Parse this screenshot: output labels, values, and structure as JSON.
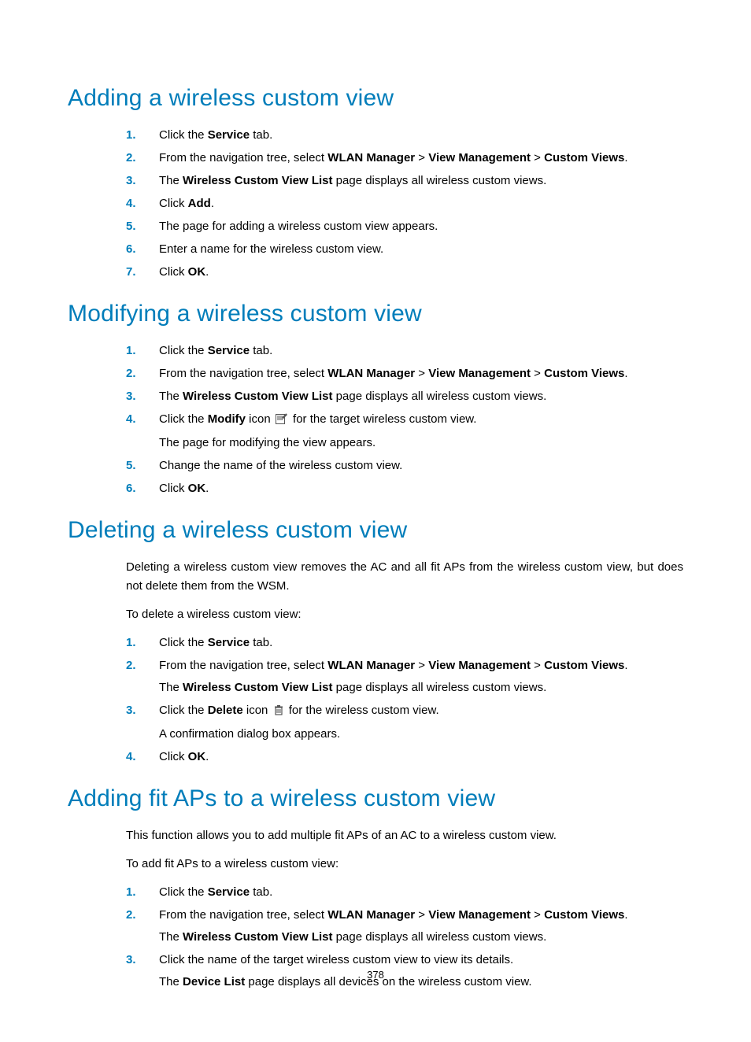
{
  "page_number": "378",
  "sections": [
    {
      "heading": "Adding a wireless custom view",
      "paragraphs": [],
      "steps": [
        {
          "num": "1.",
          "parts": [
            "Click the ",
            {
              "b": "Service"
            },
            " tab."
          ]
        },
        {
          "num": "2.",
          "parts": [
            "From the navigation tree, select ",
            {
              "b": "WLAN Manager"
            },
            " > ",
            {
              "b": "View Management"
            },
            " > ",
            {
              "b": "Custom Views"
            },
            "."
          ]
        },
        {
          "num": "3.",
          "parts": [
            "The ",
            {
              "b": "Wireless Custom View List"
            },
            " page displays all wireless custom views."
          ]
        },
        {
          "num": "4.",
          "parts": [
            "Click ",
            {
              "b": "Add"
            },
            "."
          ]
        },
        {
          "num": "5.",
          "parts": [
            "The page for adding a wireless custom view appears."
          ]
        },
        {
          "num": "6.",
          "parts": [
            "Enter a name for the wireless custom view."
          ]
        },
        {
          "num": "7.",
          "parts": [
            "Click ",
            {
              "b": "OK"
            },
            "."
          ]
        }
      ]
    },
    {
      "heading": "Modifying a wireless custom view",
      "paragraphs": [],
      "steps": [
        {
          "num": "1.",
          "parts": [
            "Click the ",
            {
              "b": "Service"
            },
            " tab."
          ]
        },
        {
          "num": "2.",
          "parts": [
            "From the navigation tree, select ",
            {
              "b": "WLAN Manager"
            },
            " > ",
            {
              "b": "View Management"
            },
            " > ",
            {
              "b": "Custom Views"
            },
            "."
          ]
        },
        {
          "num": "3.",
          "parts": [
            "The ",
            {
              "b": "Wireless Custom View List"
            },
            " page displays all wireless custom views."
          ]
        },
        {
          "num": "4.",
          "parts": [
            "Click the ",
            {
              "b": "Modify"
            },
            " icon ",
            {
              "icon": "modify"
            },
            " for the target wireless custom view."
          ],
          "sub": [
            "The page for modifying the view appears."
          ]
        },
        {
          "num": "5.",
          "parts": [
            "Change the name of the wireless custom view."
          ]
        },
        {
          "num": "6.",
          "parts": [
            "Click ",
            {
              "b": "OK"
            },
            "."
          ]
        }
      ]
    },
    {
      "heading": "Deleting a wireless custom view",
      "paragraphs": [
        "Deleting a wireless custom view removes the AC and all fit APs from the wireless custom view, but does not delete them from the WSM.",
        "To delete a wireless custom view:"
      ],
      "steps": [
        {
          "num": "1.",
          "parts": [
            "Click the ",
            {
              "b": "Service"
            },
            " tab."
          ]
        },
        {
          "num": "2.",
          "parts": [
            "From the navigation tree, select ",
            {
              "b": "WLAN Manager"
            },
            " > ",
            {
              "b": "View Management"
            },
            " > ",
            {
              "b": "Custom Views"
            },
            "."
          ],
          "sub_parts": [
            "The ",
            {
              "b": "Wireless Custom View List"
            },
            " page displays all wireless custom views."
          ]
        },
        {
          "num": "3.",
          "parts": [
            "Click the ",
            {
              "b": "Delete"
            },
            " icon ",
            {
              "icon": "delete"
            },
            " for the wireless custom view."
          ],
          "sub": [
            "A confirmation dialog box appears."
          ]
        },
        {
          "num": "4.",
          "parts": [
            "Click ",
            {
              "b": "OK"
            },
            "."
          ]
        }
      ]
    },
    {
      "heading": "Adding fit APs to a wireless custom view",
      "paragraphs": [
        "This function allows you to add multiple fit APs of an AC to a wireless custom view.",
        "To add fit APs to a wireless custom view:"
      ],
      "steps": [
        {
          "num": "1.",
          "parts": [
            "Click the ",
            {
              "b": "Service"
            },
            " tab."
          ]
        },
        {
          "num": "2.",
          "parts": [
            "From the navigation tree, select ",
            {
              "b": "WLAN Manager"
            },
            " > ",
            {
              "b": "View Management"
            },
            " > ",
            {
              "b": "Custom Views"
            },
            "."
          ],
          "sub_parts": [
            "The ",
            {
              "b": "Wireless Custom View List"
            },
            " page displays all wireless custom views."
          ]
        },
        {
          "num": "3.",
          "parts": [
            "Click the name of the target wireless custom view to view its details."
          ],
          "sub_parts": [
            "The ",
            {
              "b": "Device List"
            },
            " page displays all devices on the wireless custom view."
          ]
        }
      ]
    }
  ]
}
